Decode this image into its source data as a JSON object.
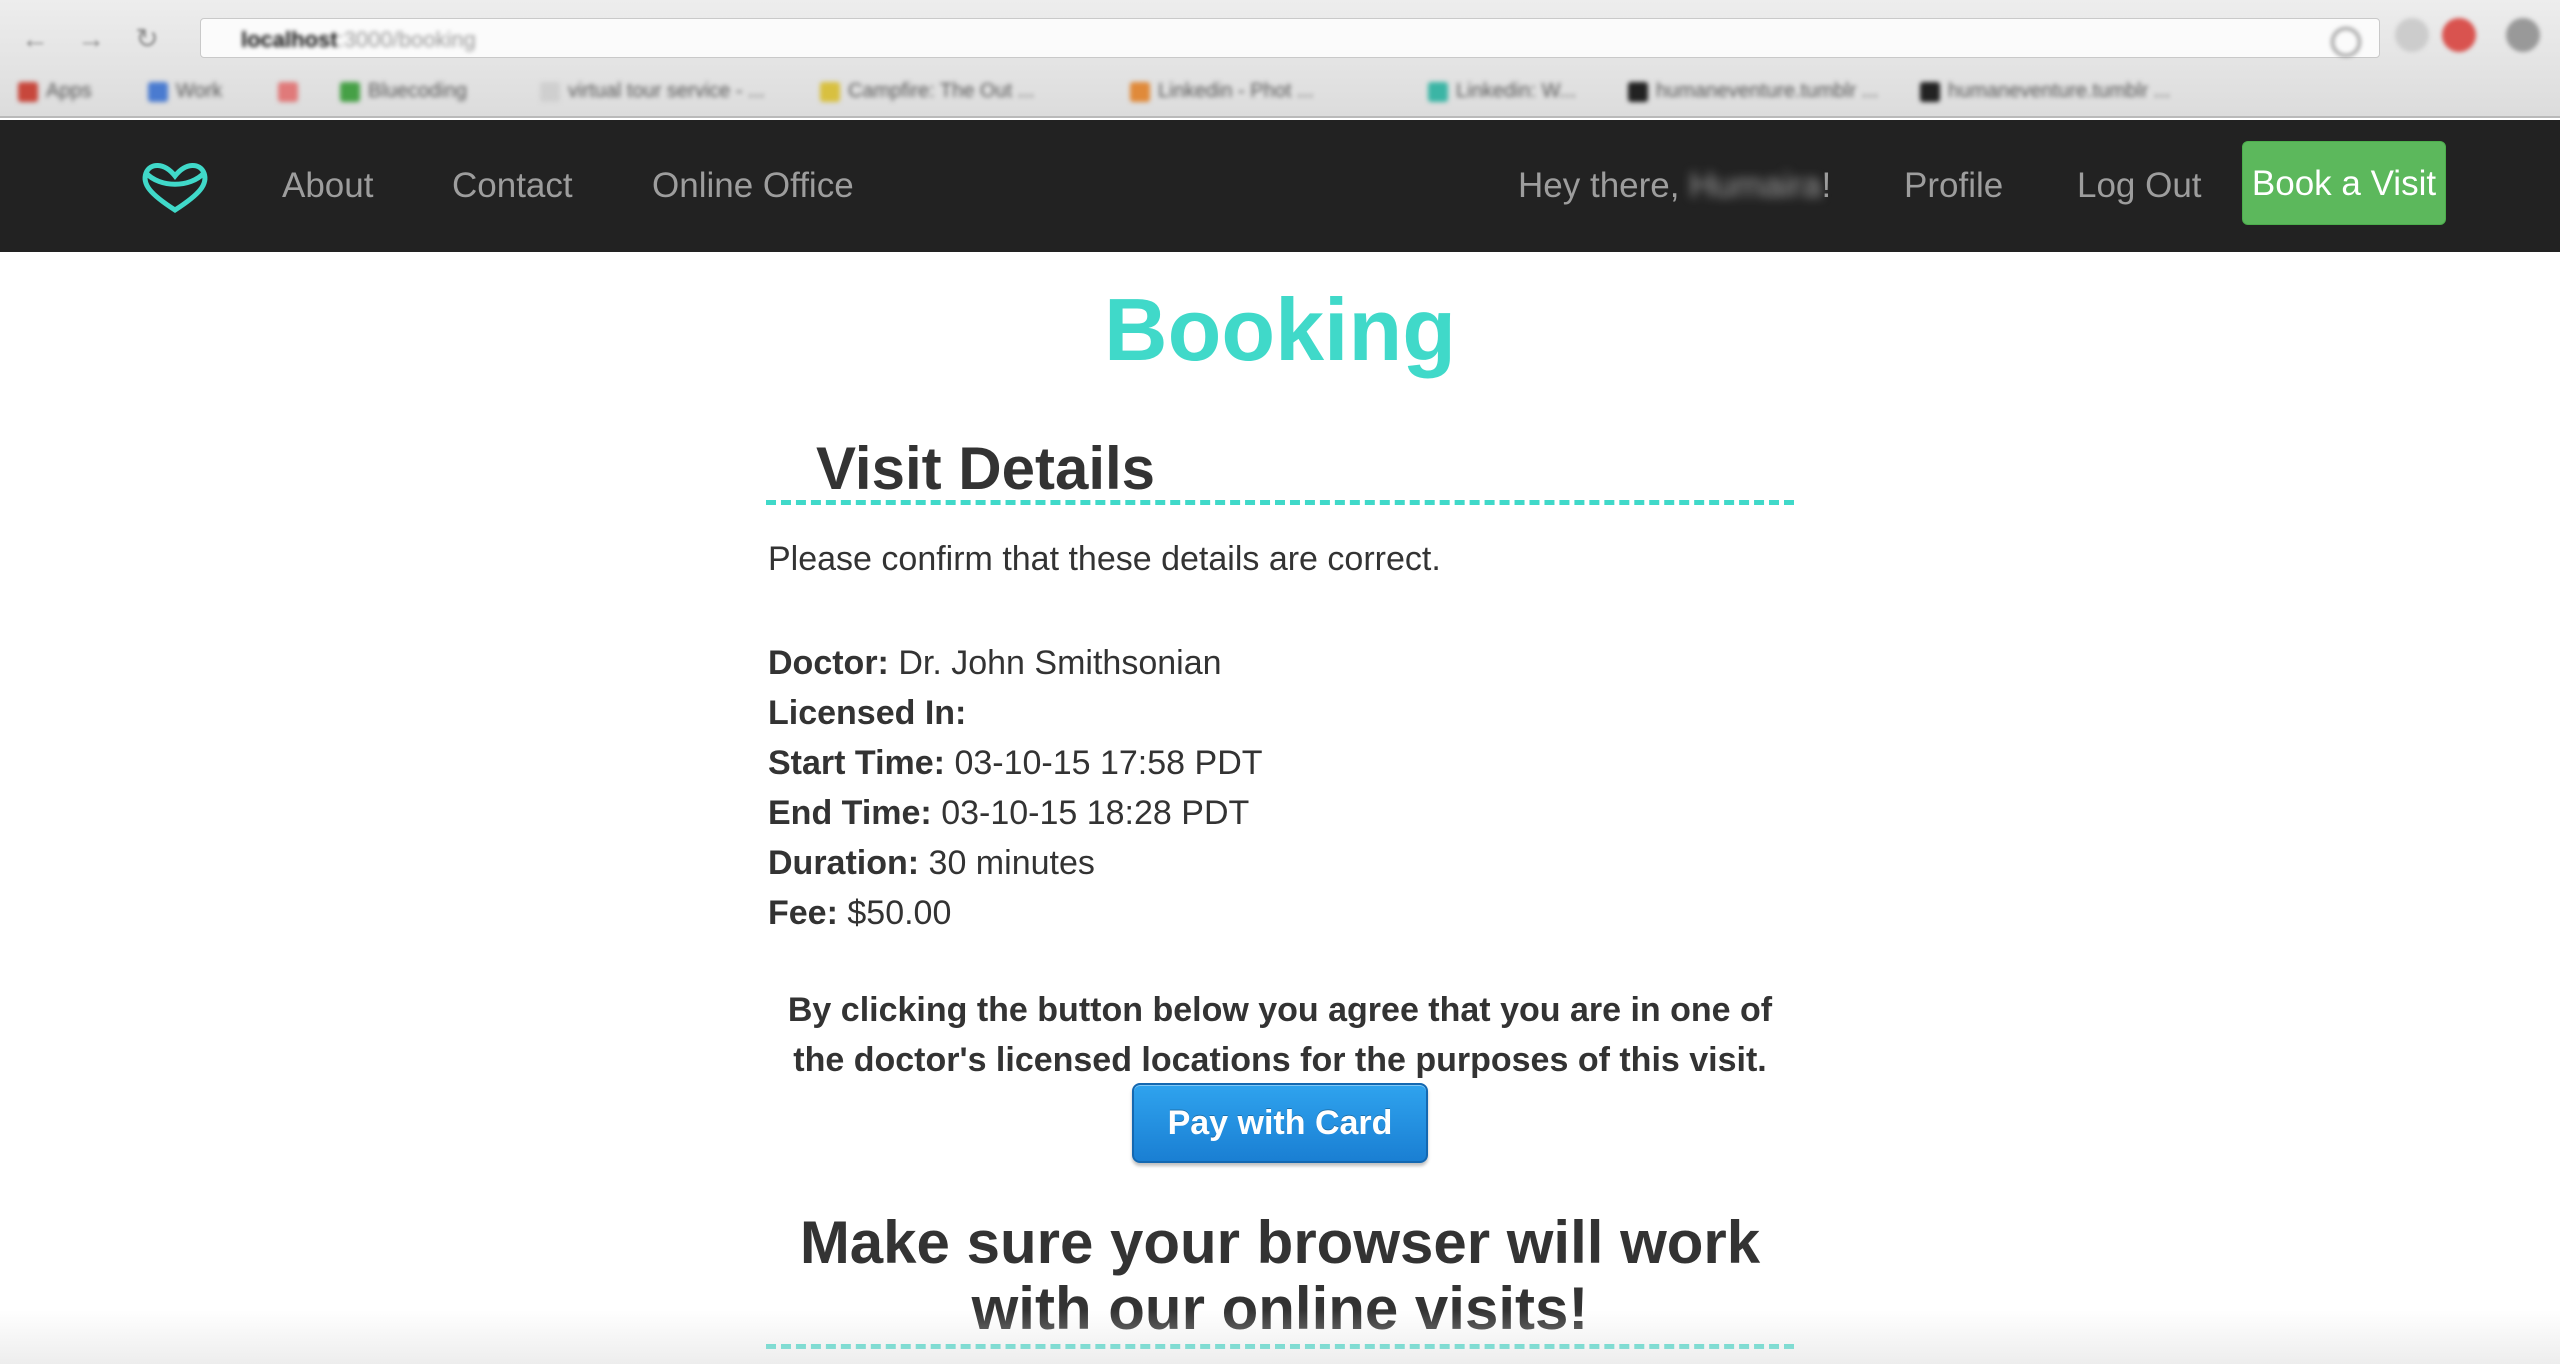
{
  "browser": {
    "address": {
      "host": "localhost",
      "path": ":3000/booking"
    },
    "bookmarks": [
      {
        "label": "Apps",
        "color": "#c7473c"
      },
      {
        "label": "Work",
        "color": "#4a7bd0"
      },
      {
        "label": "",
        "color": "#e07a7a"
      },
      {
        "label": "Bluecoding",
        "color": "#46a046"
      },
      {
        "label": "virtual tour service - ...",
        "color": "#cfcfcf"
      },
      {
        "label": "Campfire: The Out ...",
        "color": "#d8c040"
      },
      {
        "label": "Linkedin - Phot ...",
        "color": "#e08a3a"
      },
      {
        "label": "Linkedin: W...",
        "color": "#3bb5a5"
      },
      {
        "label": "humaneventure.tumblr ...",
        "color": "#222222"
      },
      {
        "label": "humaneventure.tumblr ...",
        "color": "#222222"
      }
    ]
  },
  "nav": {
    "links": [
      "About",
      "Contact",
      "Online Office"
    ],
    "greeting_prefix": "Hey there, ",
    "username": "Humaira",
    "greeting_suffix": "!",
    "profile": "Profile",
    "logout": "Log Out",
    "book_button": "Book a Visit",
    "logo_color": "#40d9c9"
  },
  "page": {
    "title": "Booking",
    "visit_details_heading": "Visit Details",
    "intro": "Please confirm that these details are correct.",
    "details": [
      {
        "label": "Doctor:",
        "value": "Dr. John Smithsonian"
      },
      {
        "label": "Licensed In:",
        "value": ""
      },
      {
        "label": "Start Time:",
        "value": "03-10-15 17:58 PDT"
      },
      {
        "label": "End Time:",
        "value": "03-10-15 18:28 PDT"
      },
      {
        "label": "Duration:",
        "value": "30 minutes"
      },
      {
        "label": "Fee:",
        "value": "$50.00"
      }
    ],
    "agreement_line1": "By clicking the button below you agree that you are in one of",
    "agreement_line2": "the doctor's licensed locations for the purposes of this visit.",
    "pay_button": "Pay with Card",
    "browser_check_line1": "Make sure your browser will work",
    "browser_check_line2": "with our online visits!"
  },
  "colors": {
    "accent": "#40d9c9",
    "nav_bg": "#222222",
    "book_button": "#5cb85c",
    "pay_button": "#1a7fd3"
  }
}
